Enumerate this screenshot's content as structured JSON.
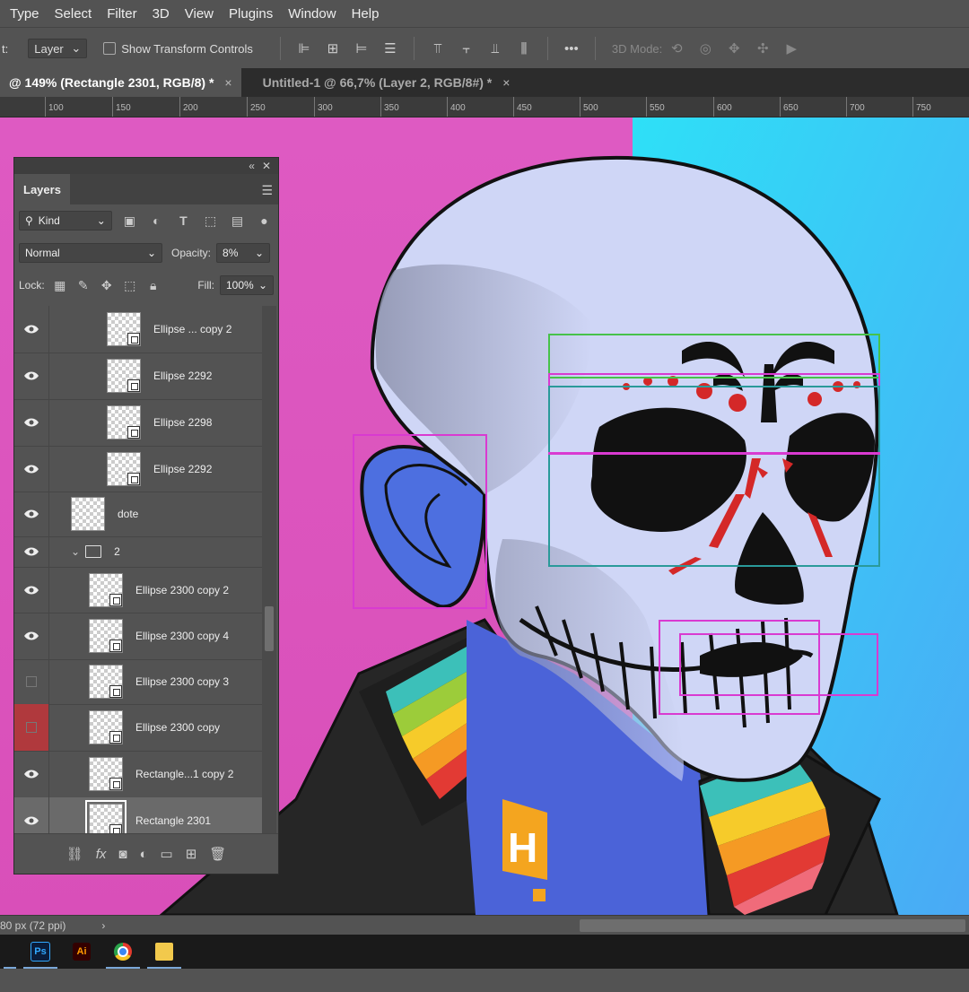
{
  "menu": [
    "Type",
    "Select",
    "Filter",
    "3D",
    "View",
    "Plugins",
    "Window",
    "Help"
  ],
  "options": {
    "label_partial": "t:",
    "auto_select_value": "Layer",
    "transform_controls_label": "Show Transform Controls",
    "more_label": "•••",
    "mode3d_label": "3D Mode:"
  },
  "tabs": [
    {
      "label": "@ 149% (Rectangle 2301, RGB/8) *",
      "close": "×"
    },
    {
      "label": "Untitled-1 @ 66,7% (Layer 2, RGB/8#) *",
      "close": "×"
    }
  ],
  "ruler": [
    "100",
    "150",
    "200",
    "250",
    "300",
    "350",
    "400",
    "450",
    "500",
    "550",
    "600",
    "650",
    "700",
    "750"
  ],
  "layers_panel": {
    "title": "Layers",
    "kind_label": "Kind",
    "blend_mode": "Normal",
    "opacity_label": "Opacity:",
    "opacity_value": "8%",
    "lock_label": "Lock:",
    "fill_label": "Fill:",
    "fill_value": "100%",
    "layers": [
      {
        "name": "Ellipse ... copy 2",
        "visible": true,
        "indent": 2
      },
      {
        "name": "Ellipse 2292",
        "visible": true,
        "indent": 2
      },
      {
        "name": "Ellipse 2298",
        "visible": true,
        "indent": 2
      },
      {
        "name": "Ellipse 2292",
        "visible": true,
        "indent": 2
      },
      {
        "name": "dote",
        "visible": true,
        "indent": 0
      },
      {
        "name": "2",
        "visible": true,
        "indent": 0,
        "group": true
      },
      {
        "name": "Ellipse 2300 copy 2",
        "visible": true,
        "indent": 1
      },
      {
        "name": "Ellipse 2300 copy 4",
        "visible": true,
        "indent": 1
      },
      {
        "name": "Ellipse 2300 copy 3",
        "visible": false,
        "indent": 1
      },
      {
        "name": "Ellipse 2300 copy",
        "visible": false,
        "indent": 1,
        "flag_color": "#b0393d"
      },
      {
        "name": "Rectangle...1 copy 2",
        "visible": true,
        "indent": 1
      },
      {
        "name": "Rectangle 2301",
        "visible": true,
        "indent": 1,
        "selected": true
      }
    ]
  },
  "status": {
    "text": "80 px (72 ppi)",
    "arrow": "›"
  },
  "taskbar": [
    {
      "app": "Ps",
      "color": "#0a1c3a",
      "text_color": "#31a8ff"
    },
    {
      "app": "Ai",
      "color": "#330000",
      "text_color": "#ff9a00"
    },
    {
      "app": "chrome",
      "color": "#ffffff",
      "text_color": "#000"
    },
    {
      "app": "files",
      "color": "#f2c94c",
      "text_color": "#000"
    }
  ],
  "colors": {
    "bg_pink": "#e05cc0",
    "bg_cyan": "#35d6f5",
    "skull": "#cfd6f6",
    "ear": "#4d6fe0",
    "blood": "#d42828"
  }
}
